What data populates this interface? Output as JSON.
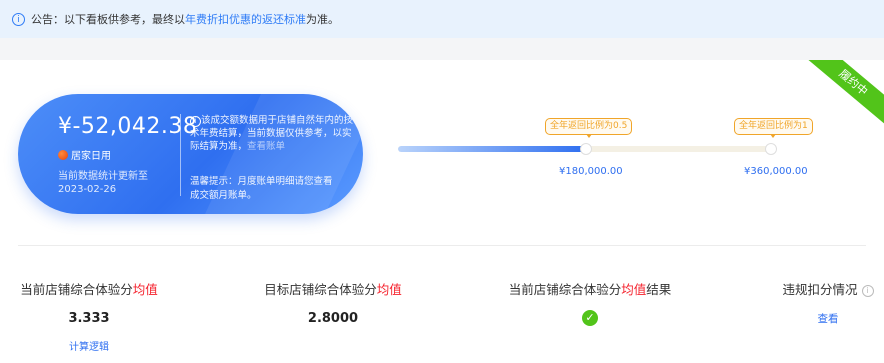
{
  "notice": {
    "text_pre": "公告：以下看板供参考，最终以",
    "text_link": "年费折扣优惠的返还标准",
    "text_post": "为准。"
  },
  "status_ribbon": "履约中",
  "summary_card": {
    "amount": "¥-52,042.38",
    "brand": "居家日用",
    "update_label": "当前数据统计更新至",
    "update_date": "2023-02-26",
    "note": "该成交额数据用于店铺自然年内的技术年费结算，当前数据仅供参考，以实际结算为准，",
    "note_link": "查看账单",
    "tip": "温馨提示：月度账单明细请您查看成交额月账单。"
  },
  "progress": {
    "current_fraction": 0.5,
    "milestones": [
      {
        "bubble": "全年返回比例为0.5",
        "amount": "¥180,000.00"
      },
      {
        "bubble": "全年返回比例为1",
        "amount": "¥360,000.00"
      }
    ]
  },
  "metrics": {
    "current_score": {
      "title_pre": "当前店铺综合体验分",
      "title_red": "均值",
      "value": "3.333",
      "link": "计算逻辑"
    },
    "target_score": {
      "title_pre": "目标店铺综合体验分",
      "title_red": "均值",
      "value": "2.8000"
    },
    "score_result": {
      "title_pre": "当前店铺综合体验分",
      "title_red": "均值",
      "title_post": "结果",
      "status_icon": "check-icon"
    },
    "violation": {
      "title": "违规扣分情况",
      "link": "查看"
    }
  },
  "colors": {
    "accent": "#2f6ff0",
    "warning": "#f0a529",
    "success": "#52c41a",
    "highlight_red": "#f5222d"
  }
}
